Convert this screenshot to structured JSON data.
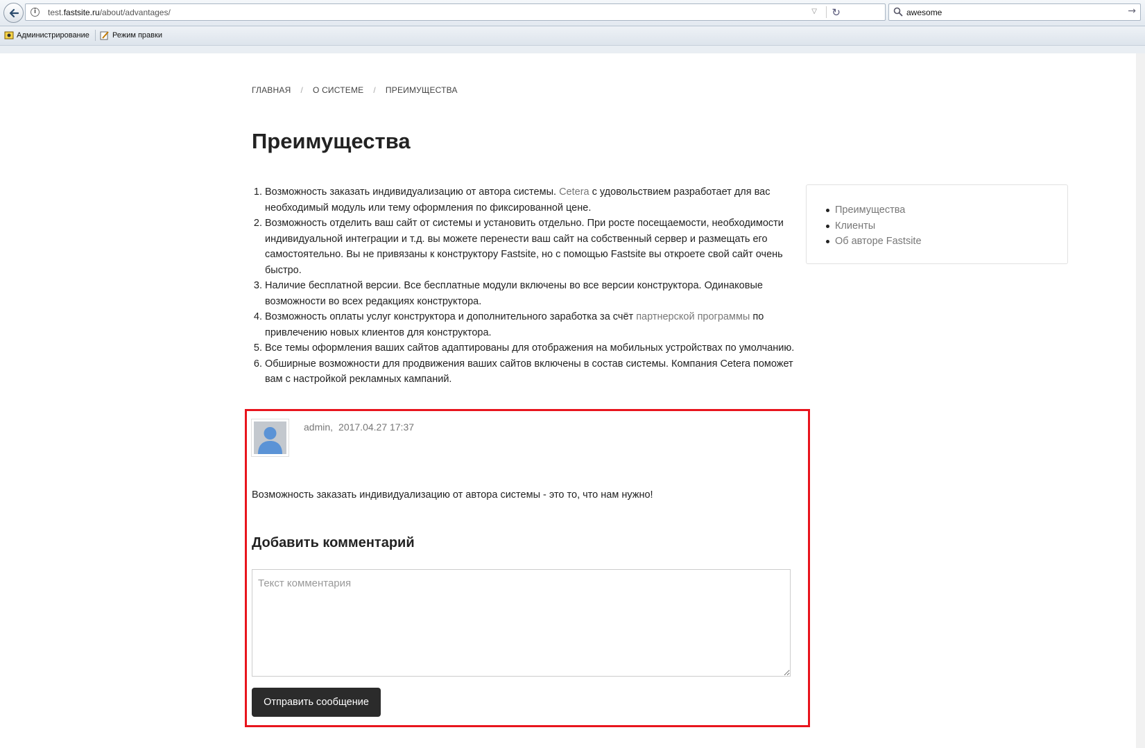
{
  "browser": {
    "url": {
      "prefix": "test.",
      "host": "fastsite.ru",
      "path": "/about/advantages/"
    },
    "search_value": "awesome",
    "bookmarks": [
      "Администрирование",
      "Режим правки"
    ]
  },
  "breadcrumb": [
    "ГЛАВНАЯ",
    "О СИСТЕМЕ",
    "ПРЕИМУЩЕСТВА"
  ],
  "breadcrumb_separator": "/",
  "page_title": "Преимущества",
  "advantages": [
    {
      "before": "Возможность заказать индивидуализацию от автора системы. ",
      "link": "Cetera",
      "after": " с удовольствием разработает для вас необходимый модуль или тему оформления по фиксированной цене."
    },
    {
      "before": "Возможность отделить ваш сайт от системы и установить отдельно. При росте посещаемости, необходимости индивидуальной интеграции и т.д. вы можете перенести ваш сайт на собственный сервер и размещать его самостоятельно. Вы не привязаны к конструктору Fastsite, но с помощью Fastsite вы откроете свой сайт очень быстро.",
      "link": "",
      "after": ""
    },
    {
      "before": "Наличие бесплатной версии. Все бесплатные модули включены во все версии конструктора. Одинаковые возможности во всех редакциях конструктора.",
      "link": "",
      "after": ""
    },
    {
      "before": "Возможность оплаты услуг конструктора и дополнительного заработка за счёт ",
      "link": "партнерской программы",
      "after": " по привлечению новых клиентов для конструктора."
    },
    {
      "before": "Все темы оформления ваших сайтов адаптированы для отображения на мобильных устройствах по умолчанию.",
      "link": "",
      "after": ""
    },
    {
      "before": "Обширные возможности для продвижения ваших сайтов включены в состав системы. Компания Cetera поможет вам с настройкой рекламных кампаний.",
      "link": "",
      "after": ""
    }
  ],
  "sidebar": {
    "items": [
      "Преимущества",
      "Клиенты",
      "Об авторе Fastsite"
    ]
  },
  "comment": {
    "author": "admin,",
    "date": "2017.04.27 17:37",
    "text": "Возможность заказать индивидуализацию от автора системы - это то, что нам нужно!"
  },
  "comment_form": {
    "heading": "Добавить комментарий",
    "placeholder": "Текст комментария",
    "submit_label": "Отправить сообщение"
  },
  "colors": {
    "highlight": "#e8141d",
    "button": "#2b2b2b",
    "link": "#777777"
  }
}
